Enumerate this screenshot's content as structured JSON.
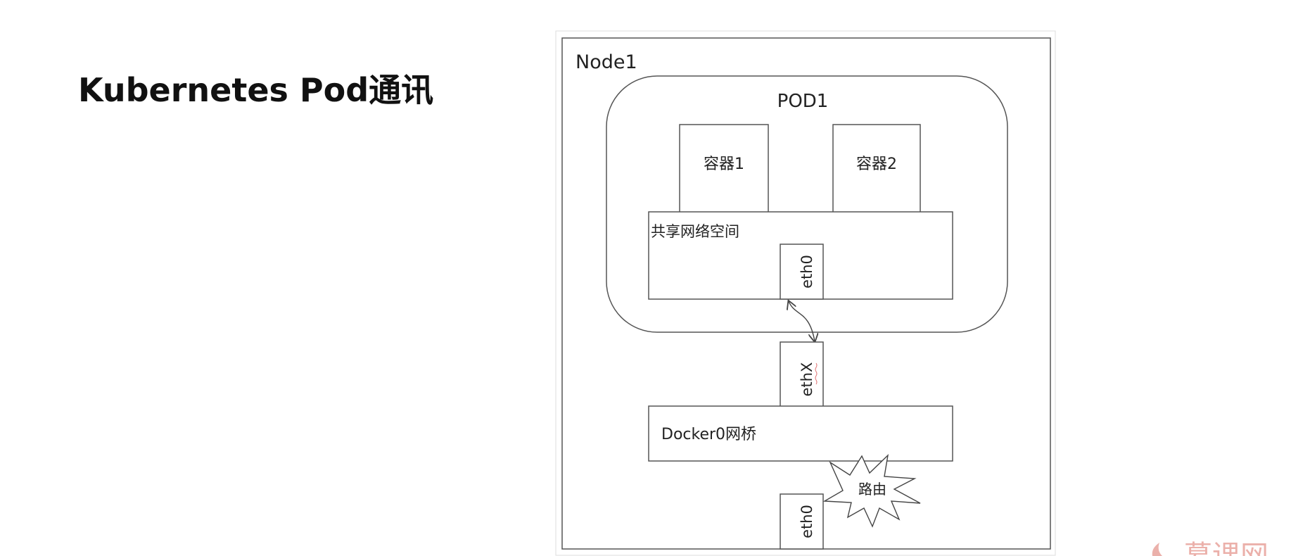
{
  "slide": {
    "title": "Kubernetes Pod通讯"
  },
  "diagram": {
    "node_label": "Node1",
    "pod_label": "POD1",
    "containers": [
      "容器1",
      "容器2"
    ],
    "shared_network_label": "共享网络空间",
    "pod_interface_label": "eth0",
    "veth_label": "ethX",
    "bridge_label": "Docker0网桥",
    "route_label": "路由",
    "node_interface_label": "eth0"
  },
  "watermark": {
    "logo_text": "慕课网",
    "color": "#e8a39c"
  },
  "colors": {
    "stroke": "#555555",
    "text": "#222222"
  }
}
